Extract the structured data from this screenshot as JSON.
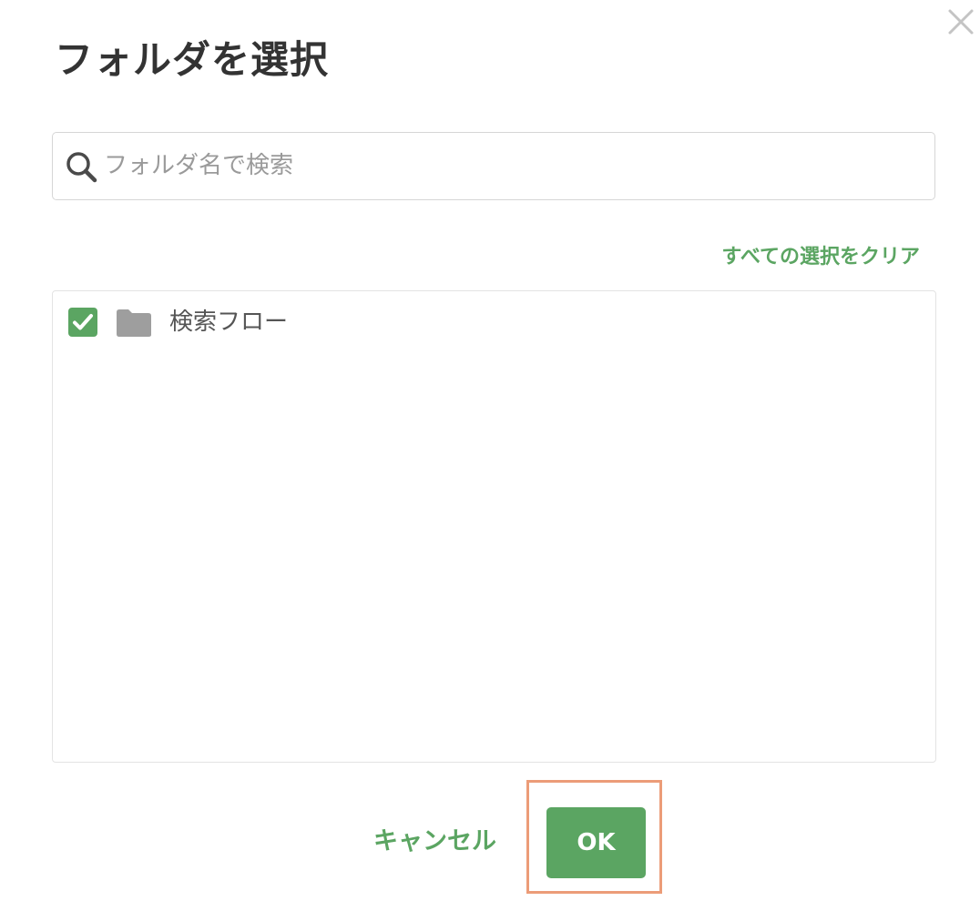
{
  "dialog": {
    "title": "フォルダを選択",
    "close_icon": "close-icon"
  },
  "search": {
    "placeholder": "フォルダ名で検索",
    "value": "",
    "icon": "search-icon"
  },
  "clear_selection_label": "すべての選択をクリア",
  "folders": [
    {
      "label": "検索フロー",
      "checked": true,
      "icon": "folder-icon"
    }
  ],
  "footer": {
    "cancel_label": "キャンセル",
    "ok_label": "OK"
  },
  "colors": {
    "accent": "#5ba562",
    "title_text": "#333333",
    "folder_icon": "#9e9e9e",
    "highlight": "#ec9c78"
  }
}
